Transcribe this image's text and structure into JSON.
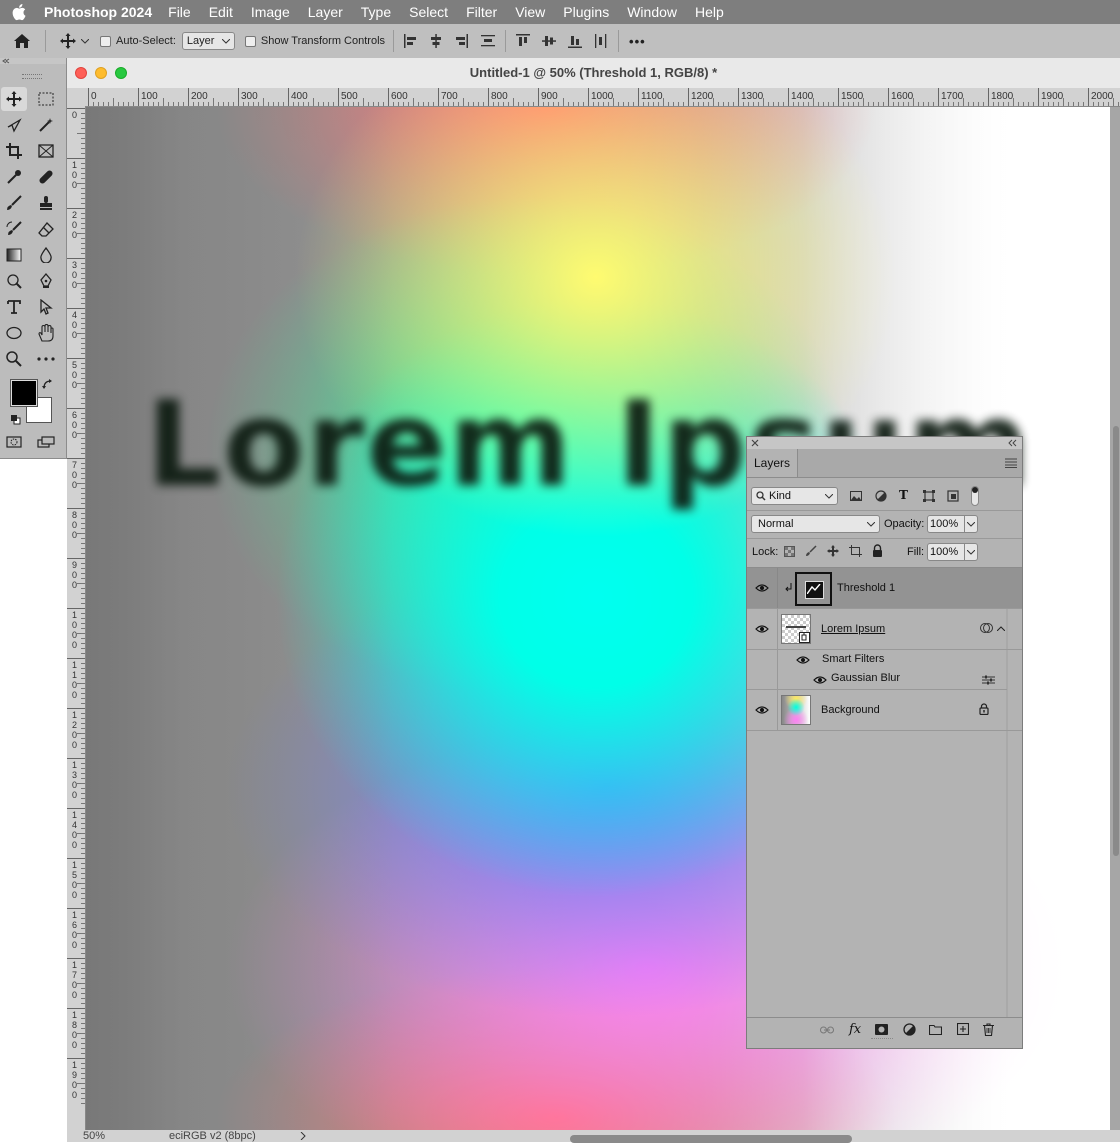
{
  "menubar": {
    "app_name": "Photoshop 2024",
    "items": [
      "File",
      "Edit",
      "Image",
      "Layer",
      "Type",
      "Select",
      "Filter",
      "View",
      "Plugins",
      "Window",
      "Help"
    ]
  },
  "options_bar": {
    "auto_select_label": "Auto-Select:",
    "auto_select_value": "Layer",
    "show_transform_label": "Show Transform Controls",
    "more_label": "•••"
  },
  "document": {
    "title": "Untitled-1 @ 50% (Threshold 1, RGB/8) *",
    "canvas_text": "Lorem Ipsum",
    "zoom": "50%",
    "color_profile": "eciRGB v2 (8bpc)",
    "h_ruler_labels": [
      "0",
      "100",
      "200",
      "300",
      "400",
      "500",
      "600",
      "700",
      "800",
      "900",
      "1000",
      "1100",
      "1200",
      "1300",
      "1400",
      "1500",
      "1600",
      "1700",
      "1800",
      "1900",
      "2000"
    ],
    "v_ruler_labels": [
      "0",
      "1\n0\n0",
      "2\n0\n0",
      "3\n0\n0",
      "4\n0\n0",
      "5\n0\n0",
      "6\n0\n0",
      "7\n0\n0",
      "8\n0\n0",
      "9\n0\n0",
      "1\n0\n0\n0",
      "1\n1\n0\n0",
      "1\n2\n0\n0",
      "1\n3\n0\n0",
      "1\n4\n0\n0",
      "1\n5\n0\n0",
      "1\n6\n0\n0",
      "1\n7\n0\n0",
      "1\n8\n0\n0",
      "1\n9\n0\n0"
    ]
  },
  "layers_panel": {
    "tab_label": "Layers",
    "filter_kind": "Kind",
    "blend_mode": "Normal",
    "opacity_label": "Opacity:",
    "opacity_value": "100%",
    "lock_label": "Lock:",
    "fill_label": "Fill:",
    "fill_value": "100%",
    "layers": [
      {
        "name": "Threshold 1"
      },
      {
        "name": "Lorem Ipsum"
      },
      {
        "name": "Background"
      }
    ],
    "smart_filters_label": "Smart Filters",
    "gaussian_blur_label": "Gaussian Blur"
  },
  "colors": {
    "menubar_bg": "#7e7e7e",
    "panel_bg": "#b3b3b3",
    "selected_layer_bg": "#939393"
  }
}
